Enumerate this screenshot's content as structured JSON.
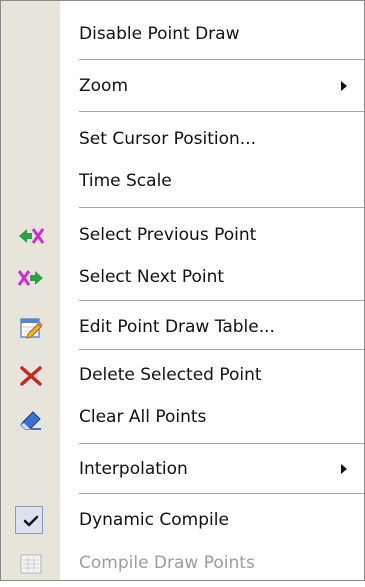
{
  "menu": {
    "items": [
      {
        "label": "Disable Point Draw",
        "icon": null,
        "submenu": false,
        "enabled": true
      },
      {
        "label": "Zoom",
        "icon": null,
        "submenu": true,
        "enabled": true
      },
      {
        "label": "Set Cursor Position...",
        "icon": null,
        "submenu": false,
        "enabled": true
      },
      {
        "label": "Time Scale",
        "icon": null,
        "submenu": false,
        "enabled": true
      },
      {
        "label": "Select Previous Point",
        "icon": "select-previous-point-icon",
        "submenu": false,
        "enabled": true
      },
      {
        "label": "Select Next Point",
        "icon": "select-next-point-icon",
        "submenu": false,
        "enabled": true
      },
      {
        "label": "Edit Point Draw Table...",
        "icon": "edit-table-icon",
        "submenu": false,
        "enabled": true
      },
      {
        "label": "Delete Selected Point",
        "icon": "delete-point-icon",
        "submenu": false,
        "enabled": true
      },
      {
        "label": "Clear All Points",
        "icon": "clear-points-icon",
        "submenu": false,
        "enabled": true
      },
      {
        "label": "Interpolation",
        "icon": null,
        "submenu": true,
        "enabled": true
      },
      {
        "label": "Dynamic Compile",
        "icon": "checkmark-icon",
        "checked": true,
        "submenu": false,
        "enabled": true
      },
      {
        "label": "Compile Draw Points",
        "icon": "compile-points-icon",
        "submenu": false,
        "enabled": false
      }
    ]
  },
  "colors": {
    "gutter": "#e7e4dc",
    "text": "#111111",
    "disabled_text": "#9c9c9c",
    "separator": "#a7a7a7",
    "green_arrow": "#2ea043",
    "magenta_x": "#d12ad1",
    "red_x": "#c62828",
    "blue_eraser": "#3c6fd6"
  }
}
